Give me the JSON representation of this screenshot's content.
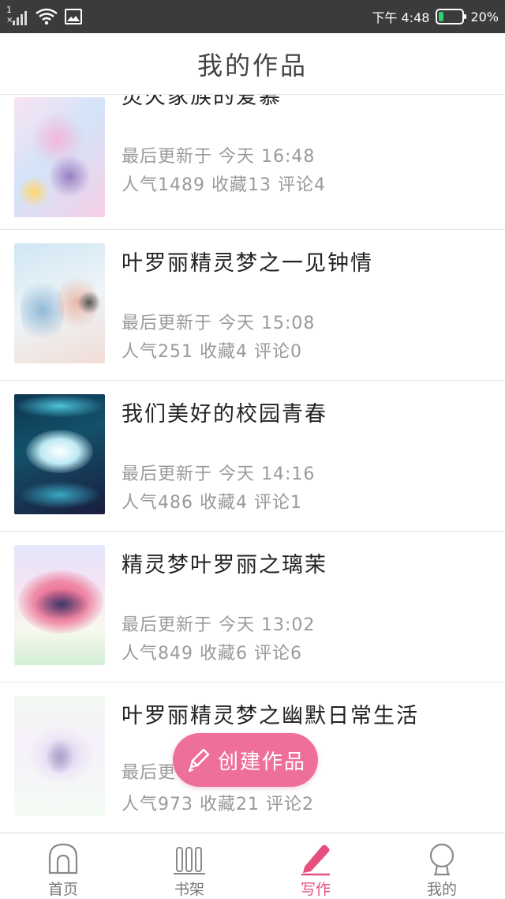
{
  "status_bar": {
    "sim_slot": "1",
    "time": "下午 4:48",
    "battery": "20%",
    "battery_color": "#2fd06e"
  },
  "header": {
    "title": "我的作品"
  },
  "works": [
    {
      "title": "灵火家族的爱慕",
      "updated": "最后更新于 今天 16:48",
      "stats": "人气1489 收藏13 评论4",
      "cover_colors": [
        "#f7d6ec",
        "#c7d9f5",
        "#fdf0f7"
      ]
    },
    {
      "title": "叶罗丽精灵梦之一见钟情",
      "updated": "最后更新于 今天 15:08",
      "stats": "人气251 收藏4 评论0",
      "cover_colors": [
        "#d7e9f4",
        "#f4e4e0",
        "#9fc6dc"
      ]
    },
    {
      "title": "我们美好的校园青春",
      "updated": "最后更新于 今天 14:16",
      "stats": "人气486 收藏4 评论1",
      "cover_colors": [
        "#0b2a3c",
        "#3fb3c9",
        "#1d1d3d"
      ]
    },
    {
      "title": "精灵梦叶罗丽之璃茉",
      "updated": "最后更新于 今天 13:02",
      "stats": "人气849 收藏6 评论6",
      "cover_colors": [
        "#e6ecf9",
        "#f06c8c",
        "#cbe9c9"
      ]
    },
    {
      "title": "叶罗丽精灵梦之幽默日常生活",
      "updated": "最后更",
      "stats": "人气973 收藏21 评论2",
      "cover_colors": [
        "#eef6ee",
        "#d9c8ee",
        "#ffffff"
      ]
    }
  ],
  "create_button": {
    "label": "创建作品",
    "color": "#ef6f9b"
  },
  "bottom_nav": [
    {
      "label": "首页",
      "icon": "home-icon",
      "active": false
    },
    {
      "label": "书架",
      "icon": "bookshelf-icon",
      "active": false
    },
    {
      "label": "写作",
      "icon": "pencil-icon",
      "active": true
    },
    {
      "label": "我的",
      "icon": "profile-icon",
      "active": false
    }
  ],
  "accent_color": "#e6507f"
}
